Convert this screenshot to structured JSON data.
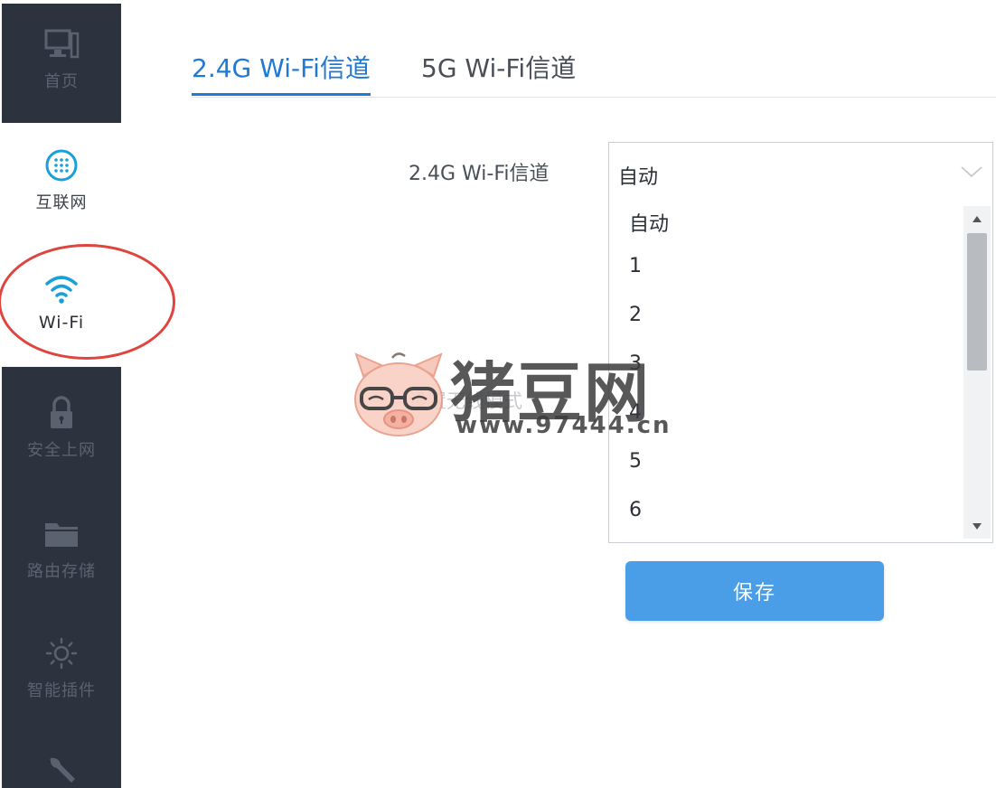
{
  "sidebar": {
    "items": [
      {
        "label": "首页",
        "icon": "monitor-icon"
      },
      {
        "label": "互联网",
        "icon": "globe-icon"
      },
      {
        "label": "Wi-Fi",
        "icon": "wifi-icon"
      },
      {
        "label": "安全上网",
        "icon": "lock-icon"
      },
      {
        "label": "路由存储",
        "icon": "folder-icon"
      },
      {
        "label": "智能插件",
        "icon": "plugin-sun-icon"
      },
      {
        "label": "",
        "icon": "wrench-icon"
      }
    ]
  },
  "tabs": [
    {
      "label": "2.4G Wi-Fi信道",
      "active": true
    },
    {
      "label": "5G Wi-Fi信道",
      "active": false
    }
  ],
  "form": {
    "channel_label": "2.4G Wi-Fi信道",
    "selected_value": "自动",
    "options": [
      "自动",
      "1",
      "2",
      "3",
      "4",
      "5",
      "6"
    ],
    "save_label": "保存",
    "faded_label": "设置无线模式"
  },
  "watermark": {
    "brand": "猪豆网",
    "url": "www.97444.cn"
  },
  "colors": {
    "accent": "#1f7ad6",
    "button": "#4a9ee8",
    "sidebar_dark": "#2c333f",
    "highlight_circle": "#e0443e",
    "wifi_icon": "#1aa0d8"
  }
}
